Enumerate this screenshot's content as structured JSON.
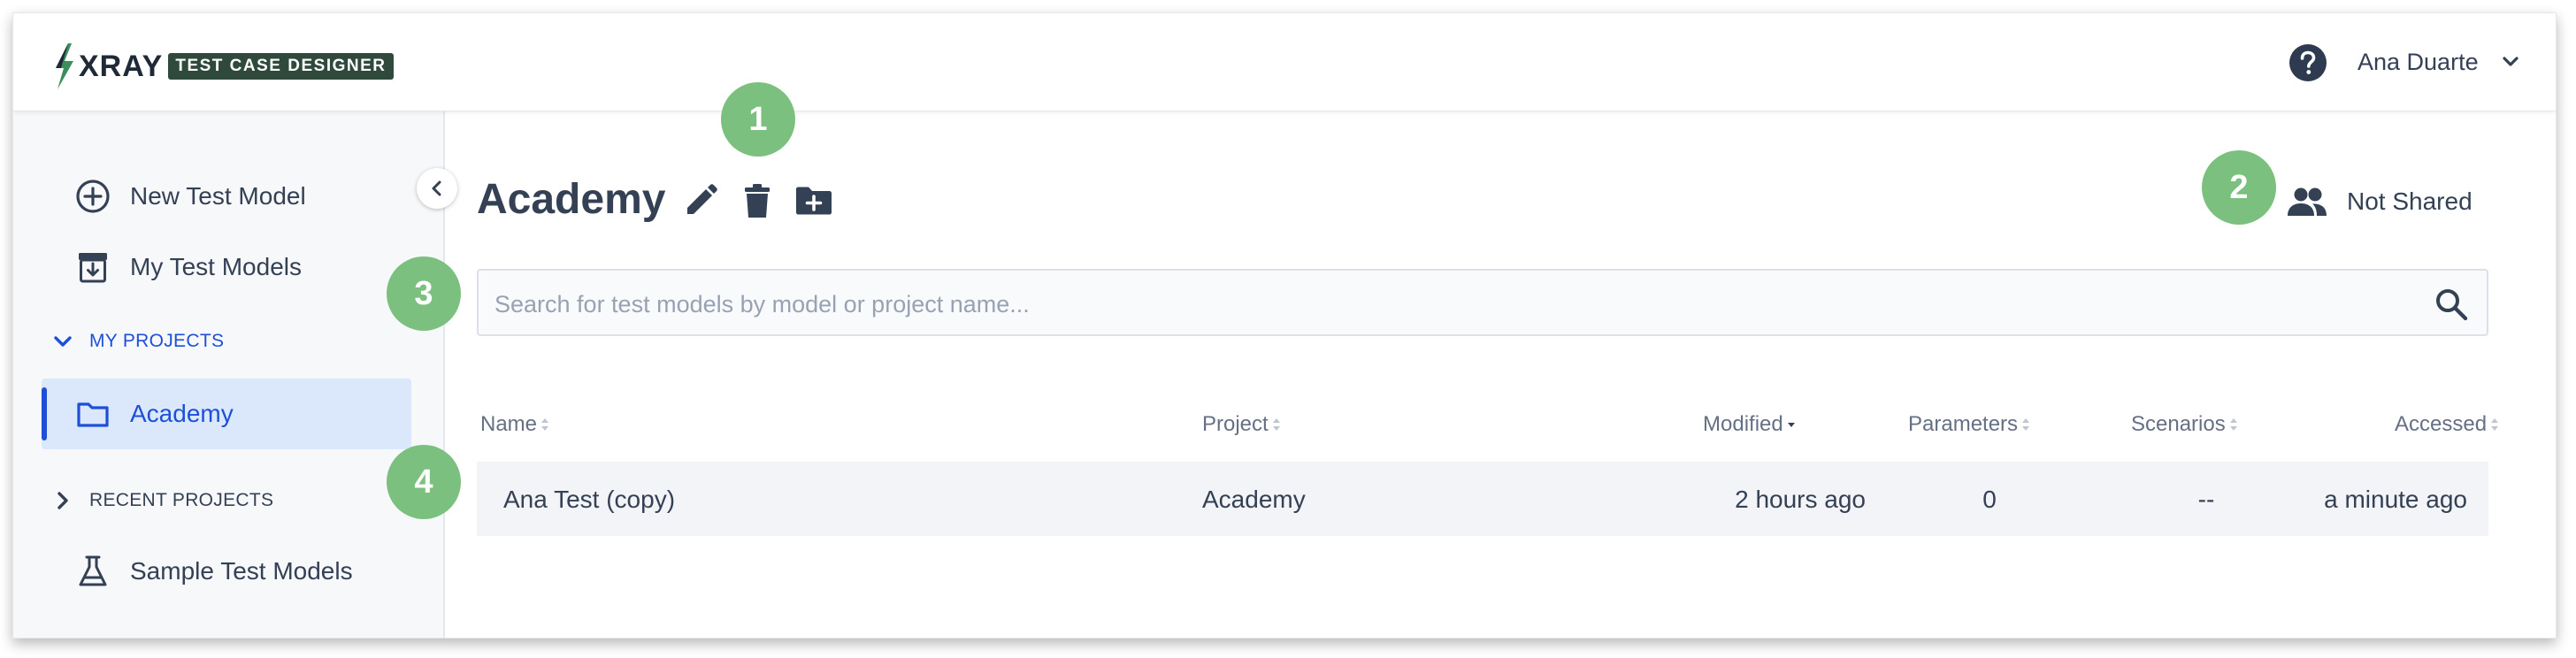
{
  "header": {
    "logo_text": "XRAY",
    "logo_badge": "TEST CASE DESIGNER",
    "user_name": "Ana Duarte"
  },
  "sidebar": {
    "new_model": "New Test Model",
    "my_models": "My Test Models",
    "my_projects_heading": "MY PROJECTS",
    "active_project": "Academy",
    "recent_projects_heading": "RECENT PROJECTS",
    "sample_models": "Sample Test Models"
  },
  "main": {
    "title": "Academy",
    "share_status": "Not Shared"
  },
  "search": {
    "placeholder": "Search for test models by model or project name..."
  },
  "table": {
    "columns": [
      "Name",
      "Project",
      "Modified",
      "Parameters",
      "Scenarios",
      "Accessed"
    ],
    "rows": [
      {
        "name": "Ana Test (copy)",
        "project": "Academy",
        "modified": "2 hours ago",
        "parameters": "0",
        "scenarios": "--",
        "accessed": "a minute ago"
      }
    ]
  },
  "markers": [
    "1",
    "2",
    "3",
    "4"
  ],
  "colors": {
    "accent": "#1d4fd8",
    "active_bg": "#dbe8fb",
    "marker": "#7cc07f",
    "text": "#344054",
    "logo_badge_bg": "#2f4a3c"
  }
}
